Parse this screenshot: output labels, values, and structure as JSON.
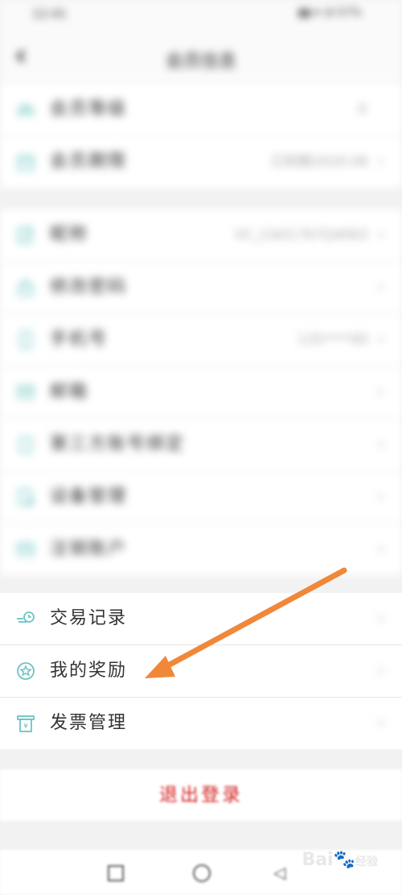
{
  "status_bar": {
    "time": "12:41",
    "system": "▮▮ ▾ ◔ 57%"
  },
  "nav": {
    "back_glyph": "‹",
    "title": "会员信息"
  },
  "group1": [
    {
      "label": "会员等级",
      "value": "0",
      "icon": "crown-icon"
    },
    {
      "label": "会员期限",
      "value": "已到期2020.06",
      "icon": "calendar-icon"
    }
  ],
  "group2": [
    {
      "label": "昵称",
      "value": "VC_CA01767Q4063",
      "icon": "edit-icon"
    },
    {
      "label": "修改密码",
      "value": "",
      "icon": "lock-icon"
    },
    {
      "label": "手机号",
      "value": "135****00",
      "icon": "phone-icon"
    },
    {
      "label": "邮箱",
      "value": "",
      "icon": "mail-icon"
    },
    {
      "label": "第三方账号绑定",
      "value": "",
      "icon": "link-icon"
    },
    {
      "label": "设备管理",
      "value": "",
      "icon": "device-icon"
    },
    {
      "label": "注销账户",
      "value": "",
      "icon": "delete-account-icon"
    }
  ],
  "group3": [
    {
      "label": "交易记录",
      "icon": "transaction-history-icon"
    },
    {
      "label": "我的奖励",
      "icon": "reward-star-icon"
    },
    {
      "label": "发票管理",
      "icon": "invoice-icon"
    }
  ],
  "logout": {
    "label": "退出登录"
  },
  "chevron": "›",
  "watermark": {
    "brand": "Bai",
    "brand_tail": "经验"
  },
  "colors": {
    "icon_teal": "#6cc4c4",
    "logout_red": "#d42020",
    "arrow_orange": "#f0883a"
  }
}
